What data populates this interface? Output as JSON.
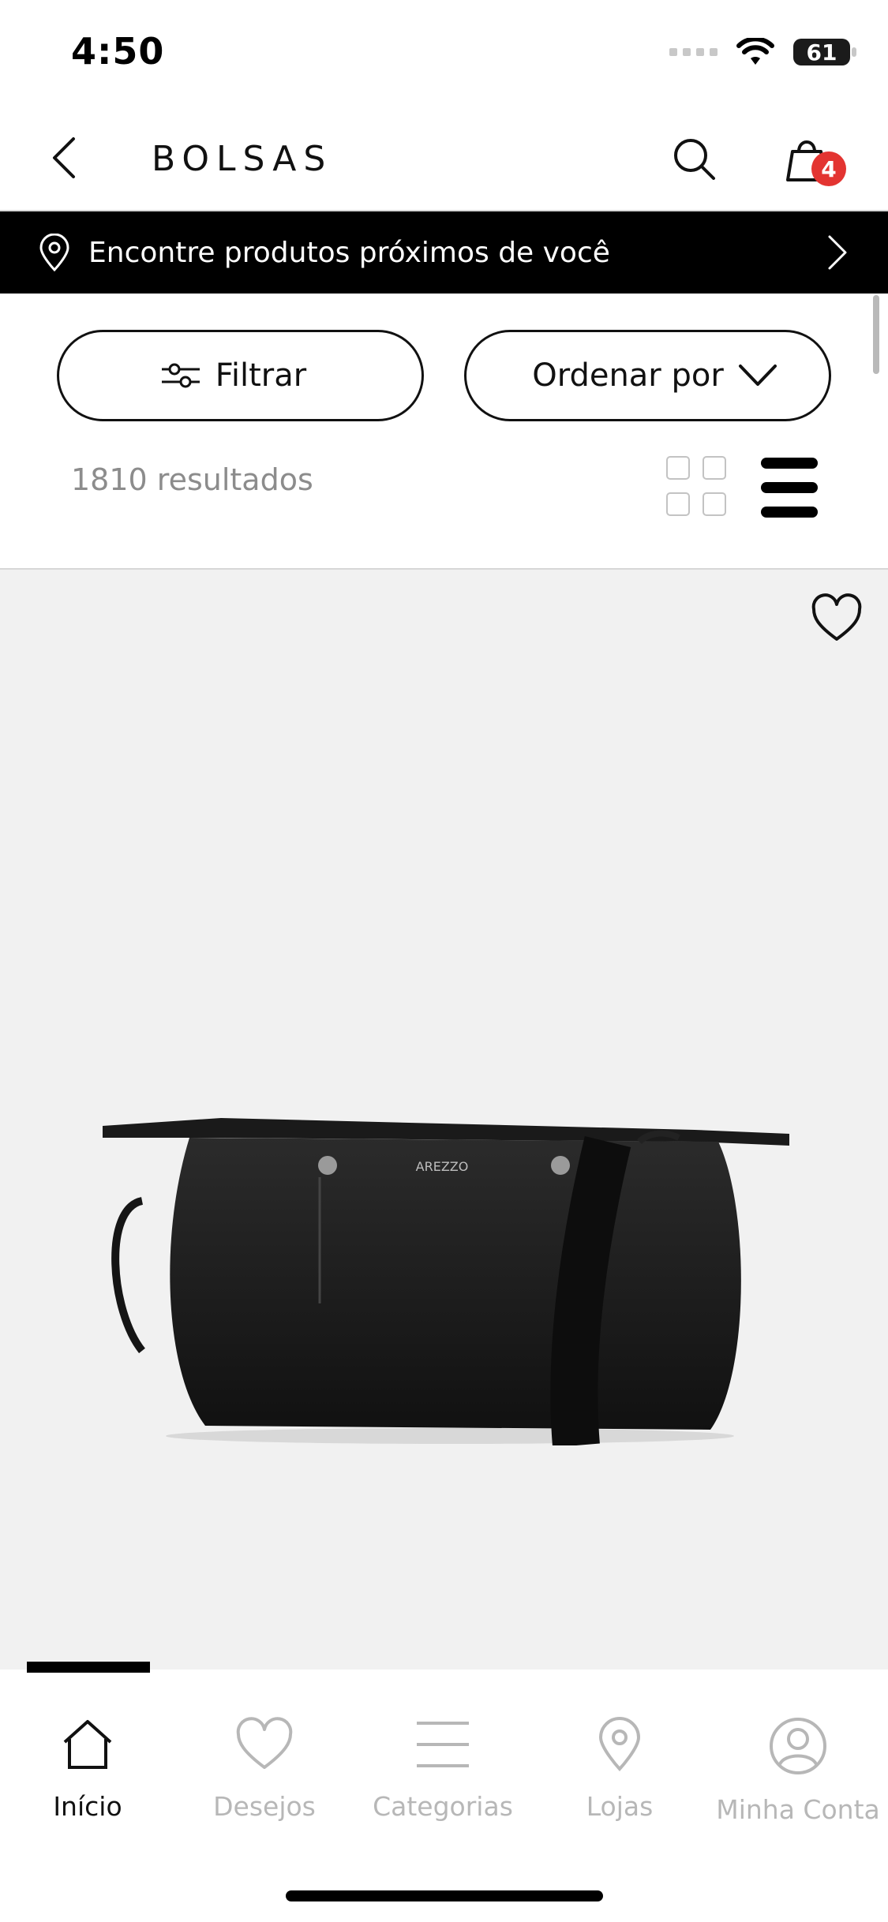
{
  "status_bar": {
    "time": "4:50",
    "battery": "61"
  },
  "header": {
    "title": "BOLSAS",
    "cart_count": "4"
  },
  "location_banner": {
    "text": "Encontre produtos próximos de você"
  },
  "controls": {
    "filter_label": "Filtrar",
    "order_label": "Ordenar por",
    "results": "1810 resultados"
  },
  "product": {
    "brand_mark": "AREZZO"
  },
  "bottom_nav": {
    "items": [
      {
        "label": "Início",
        "active": true,
        "icon": "home-icon"
      },
      {
        "label": "Desejos",
        "active": false,
        "icon": "heart-icon"
      },
      {
        "label": "Categorias",
        "active": false,
        "icon": "menu-lines-icon"
      },
      {
        "label": "Lojas",
        "active": false,
        "icon": "location-pin-icon"
      },
      {
        "label": "Minha Conta",
        "active": false,
        "icon": "user-icon"
      }
    ]
  },
  "colors": {
    "accent_badge": "#e33431",
    "banner_bg": "#000000",
    "card_bg": "#f1f1f1",
    "inactive_text": "#b7b7b7"
  }
}
